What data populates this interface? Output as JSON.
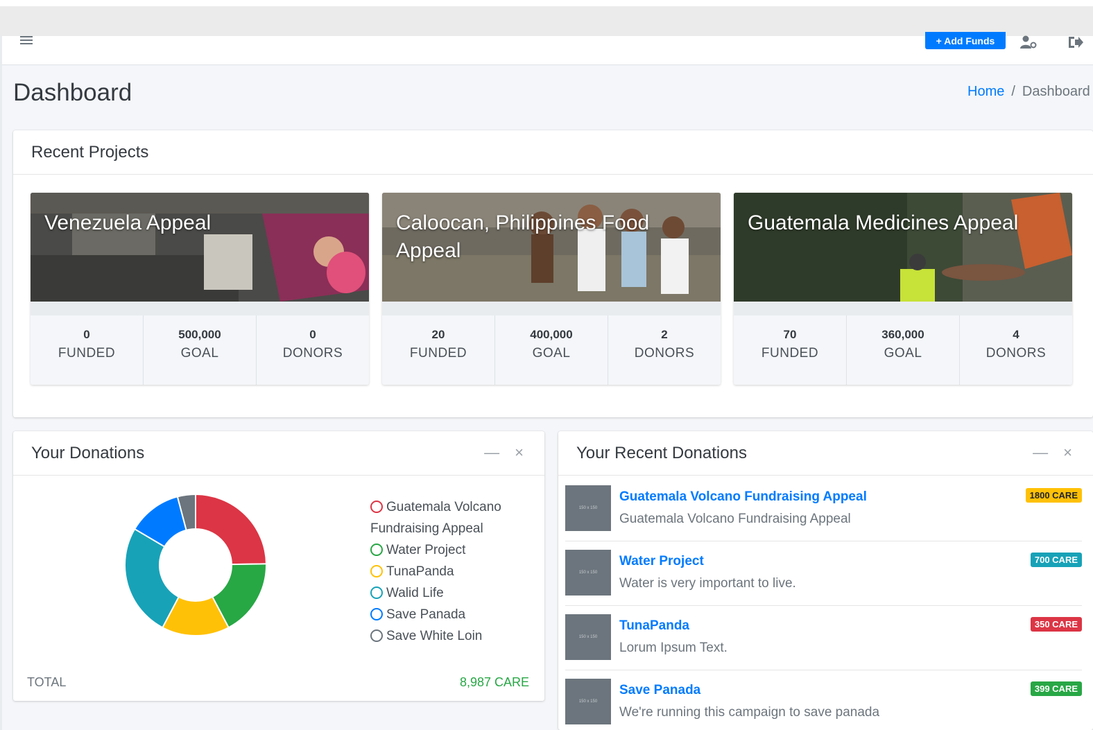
{
  "navbar": {
    "add_funds_label": "+ Add Funds"
  },
  "page": {
    "title": "Dashboard",
    "breadcrumb": {
      "home": "Home",
      "separator": "/",
      "current": "Dashboard"
    }
  },
  "recent_projects": {
    "header": "Recent Projects",
    "projects": [
      {
        "title": "Venezuela Appeal",
        "funded": "0",
        "funded_label": "FUNDED",
        "goal": "500,000",
        "goal_label": "GOAL",
        "donors": "0",
        "donors_label": "DONORS"
      },
      {
        "title": "Caloocan, Philippines Food Appeal",
        "funded": "20",
        "funded_label": "FUNDED",
        "goal": "400,000",
        "goal_label": "GOAL",
        "donors": "2",
        "donors_label": "DONORS"
      },
      {
        "title": "Guatemala Medicines Appeal",
        "funded": "70",
        "funded_label": "FUNDED",
        "goal": "360,000",
        "goal_label": "GOAL",
        "donors": "4",
        "donors_label": "DONORS"
      }
    ]
  },
  "your_donations": {
    "header": "Your Donations",
    "minimize": "—",
    "close": "×",
    "legend": [
      {
        "label": "Guatemala Volcano Fundraising Appeal",
        "color": "#dc3545"
      },
      {
        "label": "Water Project",
        "color": "#28a745"
      },
      {
        "label": "TunaPanda",
        "color": "#ffc107"
      },
      {
        "label": "Walid Life",
        "color": "#17a2b8"
      },
      {
        "label": "Save Panada",
        "color": "#007bff"
      },
      {
        "label": "Save White Loin",
        "color": "#6c757d"
      }
    ],
    "total_label": "TOTAL",
    "total_value": "8,987 CARE"
  },
  "chart_data": {
    "type": "pie",
    "categories": [
      "Guatemala Volcano Fundraising Appeal",
      "Water Project",
      "TunaPanda",
      "Walid Life",
      "Save Panada",
      "Save White Loin"
    ],
    "values": [
      24,
      17,
      15,
      25,
      12,
      4
    ],
    "colors": [
      "#dc3545",
      "#28a745",
      "#ffc107",
      "#17a2b8",
      "#007bff",
      "#6c757d"
    ],
    "donut": true,
    "legend_position": "right"
  },
  "recent_donations": {
    "header": "Your Recent Donations",
    "minimize": "—",
    "close": "×",
    "items": [
      {
        "title": "Guatemala Volcano Fundraising Appeal",
        "desc": "Guatemala Volcano Fundraising Appeal",
        "badge": "1800 CARE",
        "badge_color": "#ffc107",
        "thumb": "150 x 150"
      },
      {
        "title": "Water Project",
        "desc": "Water is very important to live.",
        "badge": "700 CARE",
        "badge_color": "#17a2b8",
        "thumb": "150 x 150"
      },
      {
        "title": "TunaPanda",
        "desc": "Lorum Ipsum Text.",
        "badge": "350 CARE",
        "badge_color": "#dc3545",
        "thumb": "150 x 150"
      },
      {
        "title": "Save Panada",
        "desc": "We're running this campaign to save panada",
        "badge": "399 CARE",
        "badge_color": "#28a745",
        "thumb": "150 x 150"
      }
    ]
  }
}
